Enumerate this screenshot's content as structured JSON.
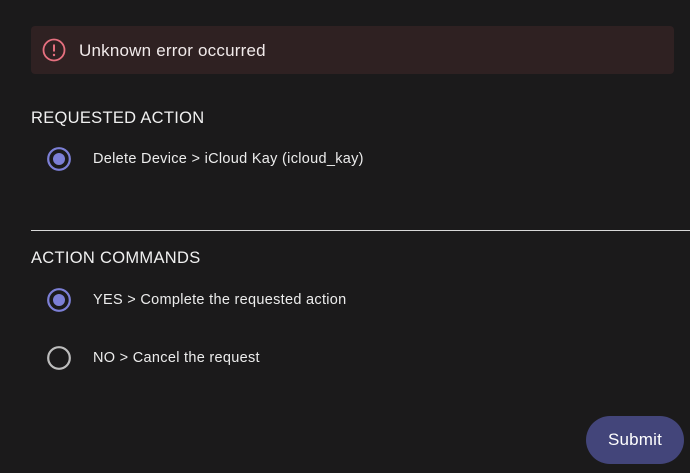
{
  "alert": {
    "icon": "error-circle-icon",
    "message": "Unknown error occurred",
    "accent_color": "#e6707f"
  },
  "requested_action": {
    "title": "REQUESTED ACTION",
    "options": [
      {
        "label": "Delete Device > iCloud Kay (icloud_kay)",
        "selected": true
      }
    ]
  },
  "action_commands": {
    "title": "ACTION COMMANDS",
    "options": [
      {
        "label": "YES > Complete the requested action",
        "selected": true
      },
      {
        "label": "NO > Cancel the request",
        "selected": false
      }
    ]
  },
  "submit": {
    "label": "Submit",
    "color": "#43457a"
  },
  "colors": {
    "background": "#1b1a1b",
    "radio_selected": "#7c7fd6",
    "radio_unselected": "#bdbdbd"
  }
}
